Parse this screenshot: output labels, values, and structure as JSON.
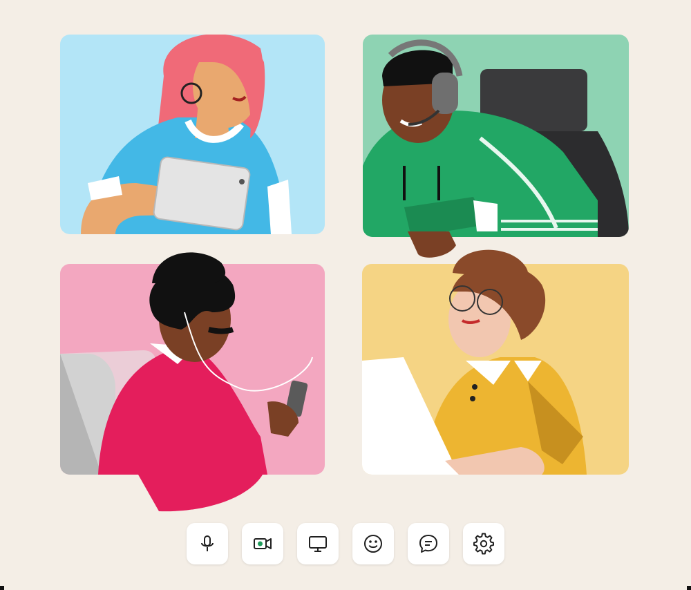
{
  "participants": [
    {
      "id": "p1",
      "background": "#b3e5f7"
    },
    {
      "id": "p2",
      "background": "#8ed3b3"
    },
    {
      "id": "p3",
      "background": "#f3a7c0"
    },
    {
      "id": "p4",
      "background": "#f5d484"
    }
  ],
  "toolbar": {
    "buttons": [
      {
        "icon": "microphone-icon"
      },
      {
        "icon": "video-camera-icon"
      },
      {
        "icon": "screen-share-icon"
      },
      {
        "icon": "emoji-icon"
      },
      {
        "icon": "chat-icon"
      },
      {
        "icon": "settings-gear-icon"
      }
    ]
  },
  "colors": {
    "page_background": "#f4eee6",
    "button_background": "#ffffff",
    "icon_stroke": "#1f1f1f",
    "camera_active": "#1e9b5a"
  }
}
